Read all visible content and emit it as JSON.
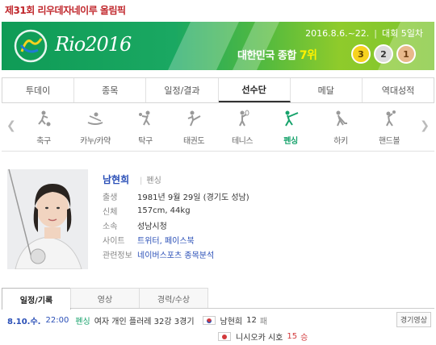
{
  "page": {
    "title": "제31회 리우데자네이루 올림픽"
  },
  "banner": {
    "logo_text": "Rio2016",
    "dates": "2016.8.6.~22.",
    "day": "대회 5일차",
    "rank_prefix": "대한민국 종합",
    "rank_value": "7위",
    "medals": {
      "gold": "3",
      "silver": "2",
      "bronze": "1"
    }
  },
  "nav": {
    "tabs": [
      "투데이",
      "종목",
      "일정/결과",
      "선수단",
      "메달",
      "역대성적"
    ]
  },
  "sports": {
    "items": [
      {
        "label": "축구",
        "icon": "soccer-icon"
      },
      {
        "label": "카누/카약",
        "icon": "canoe-icon"
      },
      {
        "label": "탁구",
        "icon": "table-tennis-icon"
      },
      {
        "label": "태권도",
        "icon": "taekwondo-icon"
      },
      {
        "label": "테니스",
        "icon": "tennis-icon"
      },
      {
        "label": "펜싱",
        "icon": "fencing-icon"
      },
      {
        "label": "하키",
        "icon": "hockey-icon"
      },
      {
        "label": "핸드볼",
        "icon": "handball-icon"
      }
    ]
  },
  "athlete": {
    "name": "남현희",
    "sport": "펜싱",
    "rows": [
      {
        "k": "출생",
        "v": "1981년 9월 29일 (경기도 성남)"
      },
      {
        "k": "신체",
        "v": "157cm, 44kg"
      },
      {
        "k": "소속",
        "v": "성남시청"
      },
      {
        "k": "사이트",
        "v": "트위터, 페이스북"
      },
      {
        "k": "관련정보",
        "v": "네이버스포츠 종목분석"
      }
    ]
  },
  "subtabs": [
    "일정/기록",
    "영상",
    "경력/수상"
  ],
  "schedule": {
    "date": "8.10.수.",
    "time": "22:00",
    "sport": "펜싱",
    "event": "여자 개인 플러레 32강 3경기",
    "p1": {
      "name": "남현희",
      "score": "12",
      "result": "패"
    },
    "p2": {
      "name": "니시오카 시호",
      "score": "15",
      "result": "승"
    },
    "video_button": "경기영상"
  },
  "colors": {
    "accent_green": "#16a26b",
    "brand_red": "#c0262b",
    "link_blue": "#2a4fb7"
  }
}
